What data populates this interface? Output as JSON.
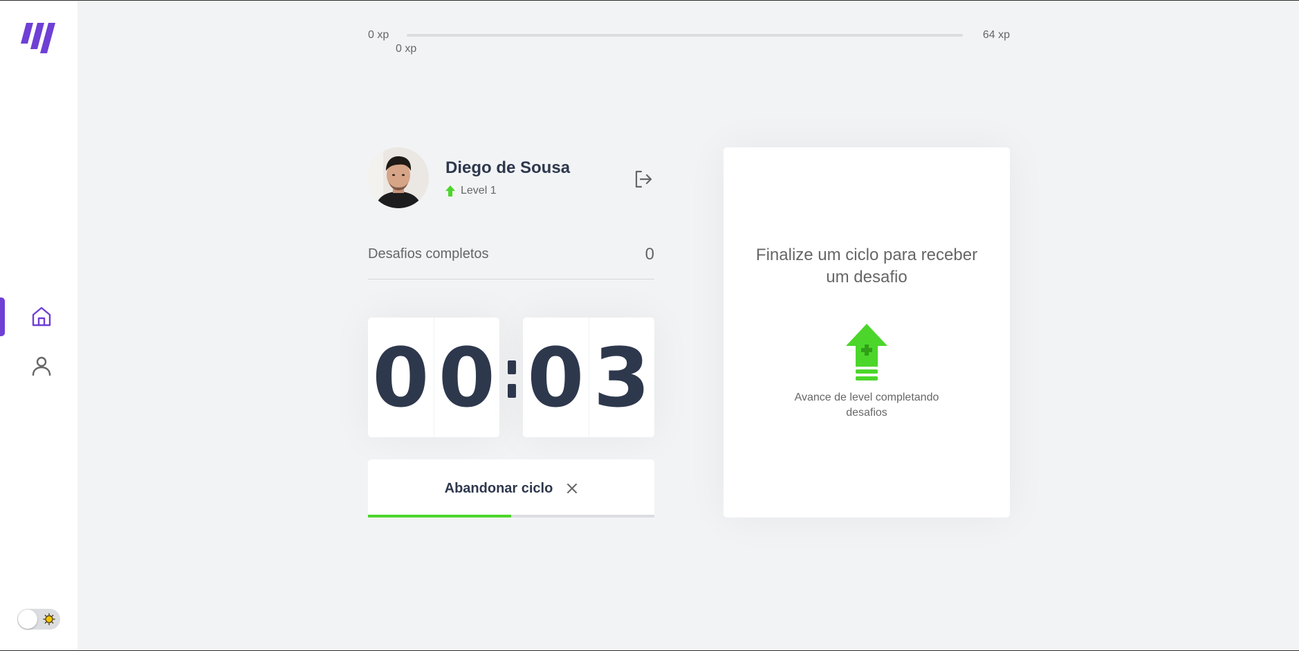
{
  "colors": {
    "background": "#f2f3f5",
    "sidebar": "#ffffff",
    "accent_purple": "#6f3fd6",
    "accent_green": "#4cd62b",
    "title_dark": "#2e384d",
    "text": "#666666"
  },
  "sidebar": {
    "logo": "move-it-logo-icon",
    "items": [
      {
        "icon": "home-icon",
        "active": true
      },
      {
        "icon": "user-icon",
        "active": false
      }
    ],
    "theme_toggle": {
      "icon": "sun-icon",
      "on": false
    }
  },
  "xp_bar": {
    "min_label": "0 xp",
    "max_label": "64 xp",
    "current_label": "0 xp",
    "progress_fraction": 0
  },
  "profile": {
    "name": "Diego de Sousa",
    "level_label": "Level 1"
  },
  "completed_challenges": {
    "label": "Desafios completos",
    "value": "0"
  },
  "countdown": {
    "minute_left": "0",
    "minute_right": "0",
    "second_left": "0",
    "second_right": "3"
  },
  "cycle_button": {
    "label": "Abandonar ciclo",
    "progress_fraction": 0.5
  },
  "challenge_box": {
    "title": "Finalize um ciclo para receber um desafio",
    "hint": "Avance de level completando desafios"
  }
}
